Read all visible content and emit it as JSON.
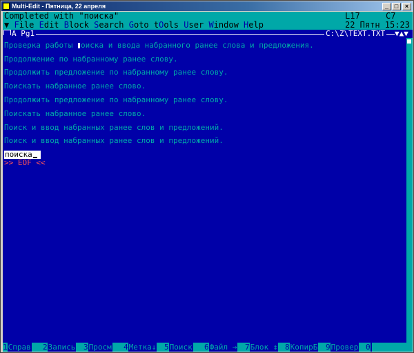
{
  "window": {
    "title": "Multi-Edit - Пятница, 22 апреля"
  },
  "status": {
    "message": "Completed with \"поиска\"",
    "line": "L17",
    "column": "C7"
  },
  "menu": {
    "items": [
      {
        "hotkey": "F",
        "rest": "ile"
      },
      {
        "hotkey": "E",
        "rest": "dit"
      },
      {
        "hotkey": "B",
        "rest": "lock"
      },
      {
        "hotkey": "S",
        "rest": "earch"
      },
      {
        "hotkey": "G",
        "rest": "oto"
      },
      {
        "hotkey": "t",
        "rest": "O",
        "tail": "ols"
      },
      {
        "hotkey": "U",
        "rest": "ser"
      },
      {
        "hotkey": "W",
        "rest": "indow"
      },
      {
        "hotkey": "H",
        "rest": "elp"
      }
    ],
    "datetime": "22 Пятн 15:23"
  },
  "tabbar": {
    "label": "A",
    "page": "Pg1",
    "path": "C:\\Z\\TEXT.TXT",
    "arrows": "▼▲▼"
  },
  "editor": {
    "lines": [
      {
        "pre": "Проверка работы ",
        "hl": "",
        "post": "оиска и ввода набранного ранее слова и предложения."
      },
      {
        "pre": "Продолжение по набранному ранее слову."
      },
      {
        "pre": "Продолжить предложение по набранному ранее слову."
      },
      {
        "pre": "Поискать набранное ранее слово."
      },
      {
        "pre": "Продолжить предложение по набранному ранее слову."
      },
      {
        "pre": "Поискать набранное ранее слово."
      },
      {
        "pre": "Поиск и ввод набранных ранее слов и предложений."
      },
      {
        "pre": "Поиск и ввод набранных ранее слов и предложений."
      }
    ],
    "input_value": "поиска",
    "eof_marker": ">> EOF <<"
  },
  "function_keys": [
    {
      "num": "1",
      "label": "Справ"
    },
    {
      "num": "2",
      "label": "Запись"
    },
    {
      "num": "3",
      "label": "Просм"
    },
    {
      "num": "4",
      "label": "Метка↓"
    },
    {
      "num": "5",
      "label": "Поиск"
    },
    {
      "num": "6",
      "label": "Файл →"
    },
    {
      "num": "7",
      "label": "Блок ↕"
    },
    {
      "num": "8",
      "label": "КопирБ"
    },
    {
      "num": "9",
      "label": "Провер"
    },
    {
      "num": "0",
      "label": ""
    }
  ]
}
